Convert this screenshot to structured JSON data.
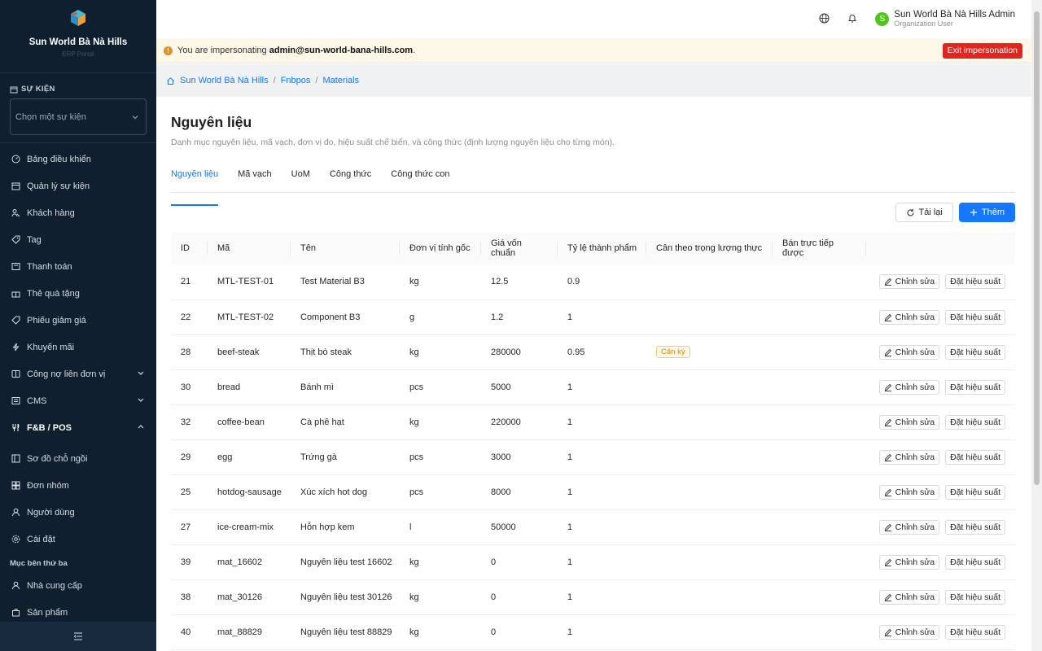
{
  "sidebar": {
    "brand_name": "Sun World Bà Nà Hills",
    "brand_sub": "ERP Portal",
    "event_section_title": "SỰ KIỆN",
    "event_select_placeholder": "Chọn một sự kiện",
    "items": [
      {
        "label": "Bảng điều khiển",
        "icon": "dashboard-icon"
      },
      {
        "label": "Quản lý sự kiện",
        "icon": "calendar-icon"
      },
      {
        "label": "Khách hàng",
        "icon": "users-icon"
      },
      {
        "label": "Tag",
        "icon": "tag-icon"
      },
      {
        "label": "Thanh toán",
        "icon": "payment-icon"
      },
      {
        "label": "Thẻ quà tặng",
        "icon": "gift-icon"
      },
      {
        "label": "Phiếu giảm giá",
        "icon": "coupon-icon"
      },
      {
        "label": "Khuyến mãi",
        "icon": "promotion-icon"
      },
      {
        "label": "Công nợ liên đơn vị",
        "icon": "ledger-icon"
      },
      {
        "label": "CMS",
        "icon": "cms-icon"
      },
      {
        "label": "F&B / POS",
        "icon": "fnb-icon"
      },
      {
        "label": "Sơ đồ chỗ ngồi",
        "icon": "seat-map-icon"
      },
      {
        "label": "Đơn nhóm",
        "icon": "group-order-icon"
      },
      {
        "label": "Người dùng",
        "icon": "user-icon"
      },
      {
        "label": "Cài đặt",
        "icon": "settings-icon"
      }
    ],
    "third_party_label": "Mục bên thứ ba",
    "third_party_items": [
      {
        "label": "Nhà cung cấp",
        "icon": "supplier-icon"
      },
      {
        "label": "Sản phẩm",
        "icon": "product-icon"
      }
    ]
  },
  "topbar": {
    "user_initial": "S",
    "user_name": "Sun World Bà Nà Hills Admin",
    "user_role": "Organization User"
  },
  "banner": {
    "prefix": "You are impersonating",
    "email": "admin@sun-world-bana-hills.com",
    "suffix": ".",
    "exit_label": "Exit impersonation"
  },
  "breadcrumb": [
    "Sun World Bà Nà Hills",
    "Fnbpos",
    "Materials"
  ],
  "page": {
    "title": "Nguyên liệu",
    "description": "Danh mục nguyên liệu, mã vạch, đơn vị đo, hiệu suất chế biến, và công thức (định lượng nguyên liệu cho từng món).",
    "tabs": [
      "Nguyên liệu",
      "Mã vạch",
      "UoM",
      "Công thức",
      "Công thức con"
    ],
    "reload_label": "Tải lại",
    "add_label": "Thêm"
  },
  "table": {
    "headers": [
      "ID",
      "Mã",
      "Tên",
      "Đơn vị tính gốc",
      "Giá vốn chuẩn",
      "Tỷ lệ thành phẩm",
      "Cân theo trọng lượng thực",
      "Bán trực tiếp được",
      ""
    ],
    "edit_label": "Chỉnh sửa",
    "yield_label": "Đặt hiệu suất",
    "weigh_tag": "Cân ký",
    "rows": [
      {
        "id": "21",
        "code": "MTL-TEST-01",
        "name": "Test Material B3",
        "uom": "kg",
        "cost": "12.5",
        "yield": "0.9",
        "weigh": false
      },
      {
        "id": "22",
        "code": "MTL-TEST-02",
        "name": "Component B3",
        "uom": "g",
        "cost": "1.2",
        "yield": "1",
        "weigh": false
      },
      {
        "id": "28",
        "code": "beef-steak",
        "name": "Thịt bò steak",
        "uom": "kg",
        "cost": "280000",
        "yield": "0.95",
        "weigh": true
      },
      {
        "id": "30",
        "code": "bread",
        "name": "Bánh mì",
        "uom": "pcs",
        "cost": "5000",
        "yield": "1",
        "weigh": false
      },
      {
        "id": "32",
        "code": "coffee-bean",
        "name": "Cà phê hạt",
        "uom": "kg",
        "cost": "220000",
        "yield": "1",
        "weigh": false
      },
      {
        "id": "29",
        "code": "egg",
        "name": "Trứng gà",
        "uom": "pcs",
        "cost": "3000",
        "yield": "1",
        "weigh": false
      },
      {
        "id": "25",
        "code": "hotdog-sausage",
        "name": "Xúc xích hot dog",
        "uom": "pcs",
        "cost": "8000",
        "yield": "1",
        "weigh": false
      },
      {
        "id": "27",
        "code": "ice-cream-mix",
        "name": "Hỗn hợp kem",
        "uom": "l",
        "cost": "50000",
        "yield": "1",
        "weigh": false
      },
      {
        "id": "39",
        "code": "mat_16602",
        "name": "Nguyên liệu test 16602",
        "uom": "kg",
        "cost": "0",
        "yield": "1",
        "weigh": false
      },
      {
        "id": "38",
        "code": "mat_30126",
        "name": "Nguyên liệu test 30126",
        "uom": "kg",
        "cost": "0",
        "yield": "1",
        "weigh": false
      },
      {
        "id": "40",
        "code": "mat_88829",
        "name": "Nguyên liệu test 88829",
        "uom": "kg",
        "cost": "0",
        "yield": "1",
        "weigh": false
      }
    ]
  }
}
